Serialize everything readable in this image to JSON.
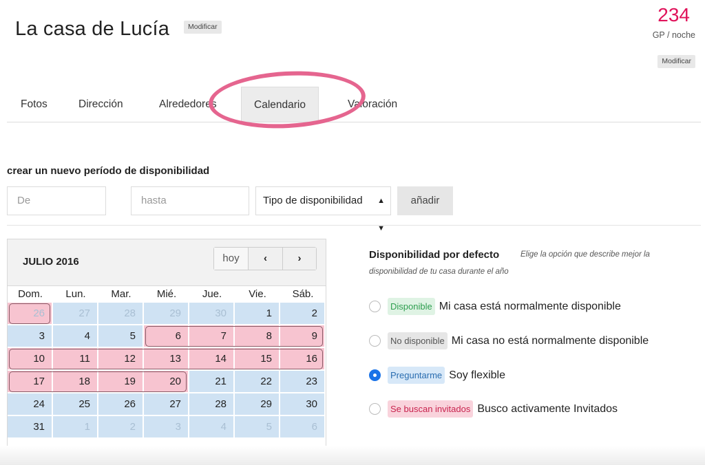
{
  "header": {
    "title": "La casa de Lucía",
    "modify_label": "Modificar",
    "price": "234",
    "price_unit": "GP / noche",
    "price_modify_label": "Modificar"
  },
  "tabs": [
    {
      "label": "Fotos"
    },
    {
      "label": "Dirección"
    },
    {
      "label": "Alrededores"
    },
    {
      "label": "Calendario",
      "active": true
    },
    {
      "label": "Valoración"
    }
  ],
  "period_form": {
    "heading": "crear un nuevo período de disponibilidad",
    "from_placeholder": "De",
    "to_placeholder": "hasta",
    "type_select": "Tipo de disponibilidad",
    "add_label": "añadir"
  },
  "calendar": {
    "month": "JULIO 2016",
    "today_label": "hoy",
    "prev_icon": "‹",
    "next_icon": "›",
    "weekdays": [
      "Dom.",
      "Lun.",
      "Mar.",
      "Mié.",
      "Jue.",
      "Vie.",
      "Sáb."
    ],
    "weeks": [
      [
        {
          "d": "26",
          "other": true,
          "booked": true
        },
        {
          "d": "27",
          "other": true
        },
        {
          "d": "28",
          "other": true
        },
        {
          "d": "29",
          "other": true
        },
        {
          "d": "30",
          "other": true
        },
        {
          "d": "1"
        },
        {
          "d": "2"
        }
      ],
      [
        {
          "d": "3"
        },
        {
          "d": "4"
        },
        {
          "d": "5"
        },
        {
          "d": "6",
          "booked": true
        },
        {
          "d": "7",
          "booked": true
        },
        {
          "d": "8",
          "booked": true
        },
        {
          "d": "9",
          "booked": true
        }
      ],
      [
        {
          "d": "10",
          "booked": true
        },
        {
          "d": "11",
          "booked": true
        },
        {
          "d": "12",
          "booked": true
        },
        {
          "d": "13",
          "booked": true
        },
        {
          "d": "14",
          "booked": true
        },
        {
          "d": "15",
          "booked": true
        },
        {
          "d": "16",
          "booked": true
        }
      ],
      [
        {
          "d": "17",
          "booked": true
        },
        {
          "d": "18",
          "booked": true
        },
        {
          "d": "19",
          "booked": true
        },
        {
          "d": "20",
          "booked": true
        },
        {
          "d": "21"
        },
        {
          "d": "22"
        },
        {
          "d": "23"
        }
      ],
      [
        {
          "d": "24"
        },
        {
          "d": "25"
        },
        {
          "d": "26"
        },
        {
          "d": "27"
        },
        {
          "d": "28"
        },
        {
          "d": "29"
        },
        {
          "d": "30"
        }
      ],
      [
        {
          "d": "31"
        },
        {
          "d": "1",
          "other": true
        },
        {
          "d": "2",
          "other": true
        },
        {
          "d": "3",
          "other": true
        },
        {
          "d": "4",
          "other": true
        },
        {
          "d": "5",
          "other": true
        },
        {
          "d": "6",
          "other": true
        }
      ]
    ],
    "colors": {
      "free": "#cfe2f3",
      "booked": "#f7c4d0"
    }
  },
  "availability": {
    "heading": "Disponibilidad por defecto",
    "hint_line1": "Elige la opción que describe mejor la",
    "hint_line2": "disponibilidad de tu casa durante el año",
    "options": [
      {
        "badge": "Disponible",
        "text": "Mi casa está normalmente disponible",
        "checked": false,
        "badge_bg": "#dff3e4",
        "badge_fg": "#2e9e4f"
      },
      {
        "badge": "No disponible",
        "text": "Mi casa no está normalmente disponible",
        "checked": false,
        "badge_bg": "#e6e6e6",
        "badge_fg": "#555555"
      },
      {
        "badge": "Preguntarme",
        "text": "Soy flexible",
        "checked": true,
        "badge_bg": "#d7e8f8",
        "badge_fg": "#2a6db0"
      },
      {
        "badge": "Se buscan invitados",
        "text": "Busco activamente Invitados",
        "checked": false,
        "badge_bg": "#f9d3dc",
        "badge_fg": "#c8234e"
      }
    ]
  },
  "accent_color": "#e0125a",
  "highlight_color": "#e5658f"
}
